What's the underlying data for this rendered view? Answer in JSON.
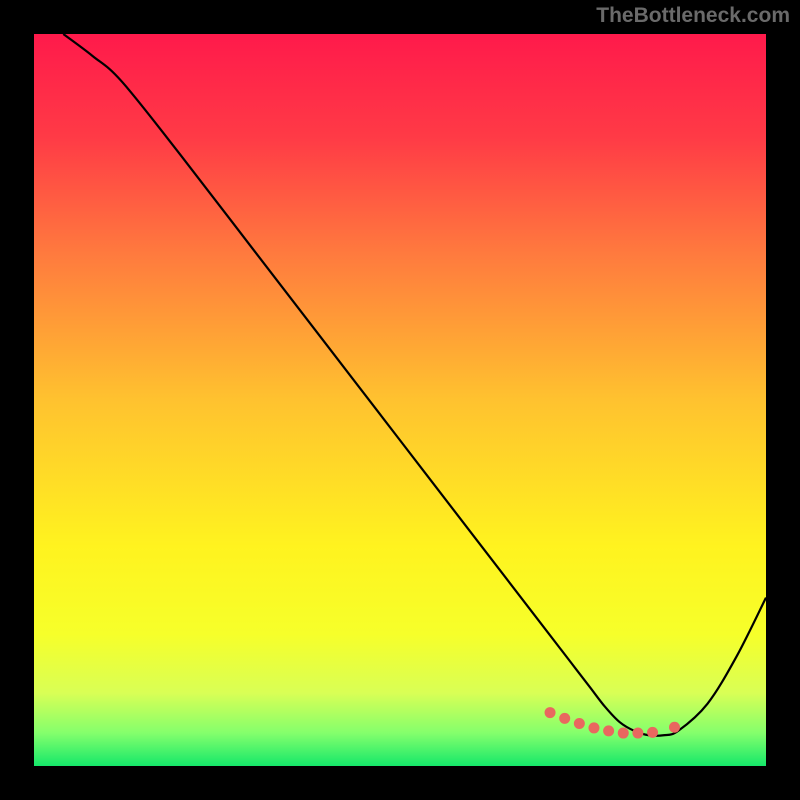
{
  "attribution": "TheBottleneck.com",
  "chart_data": {
    "type": "line",
    "title": "",
    "xlabel": "",
    "ylabel": "",
    "xlim": [
      0,
      100
    ],
    "ylim": [
      0,
      100
    ],
    "series": [
      {
        "name": "curve",
        "x": [
          4,
          8,
          12,
          20,
          30,
          40,
          50,
          60,
          68,
          72,
          74,
          76,
          78,
          80,
          82,
          84,
          86,
          88,
          92,
          96,
          100
        ],
        "y": [
          100,
          97,
          93.5,
          83.5,
          70.5,
          57.5,
          44.5,
          31.5,
          21.1,
          15.9,
          13.3,
          10.7,
          8.1,
          6,
          4.8,
          4.2,
          4.2,
          4.8,
          8.5,
          15,
          23
        ]
      },
      {
        "name": "markers",
        "x": [
          70.5,
          72.5,
          74.5,
          76.5,
          78.5,
          80.5,
          82.5,
          84.5,
          87.5
        ],
        "y": [
          7.3,
          6.5,
          5.8,
          5.2,
          4.8,
          4.5,
          4.5,
          4.6,
          5.3
        ]
      }
    ],
    "gradient_stops": [
      {
        "offset": 0,
        "color": "#ff1a4b"
      },
      {
        "offset": 0.14,
        "color": "#ff3a46"
      },
      {
        "offset": 0.3,
        "color": "#ff7a3e"
      },
      {
        "offset": 0.5,
        "color": "#ffc22f"
      },
      {
        "offset": 0.7,
        "color": "#fff31f"
      },
      {
        "offset": 0.82,
        "color": "#f6ff2a"
      },
      {
        "offset": 0.9,
        "color": "#d9ff55"
      },
      {
        "offset": 0.955,
        "color": "#84ff6c"
      },
      {
        "offset": 1.0,
        "color": "#15e86a"
      }
    ],
    "marker_color": "#e9675f",
    "line_color": "#000000"
  }
}
